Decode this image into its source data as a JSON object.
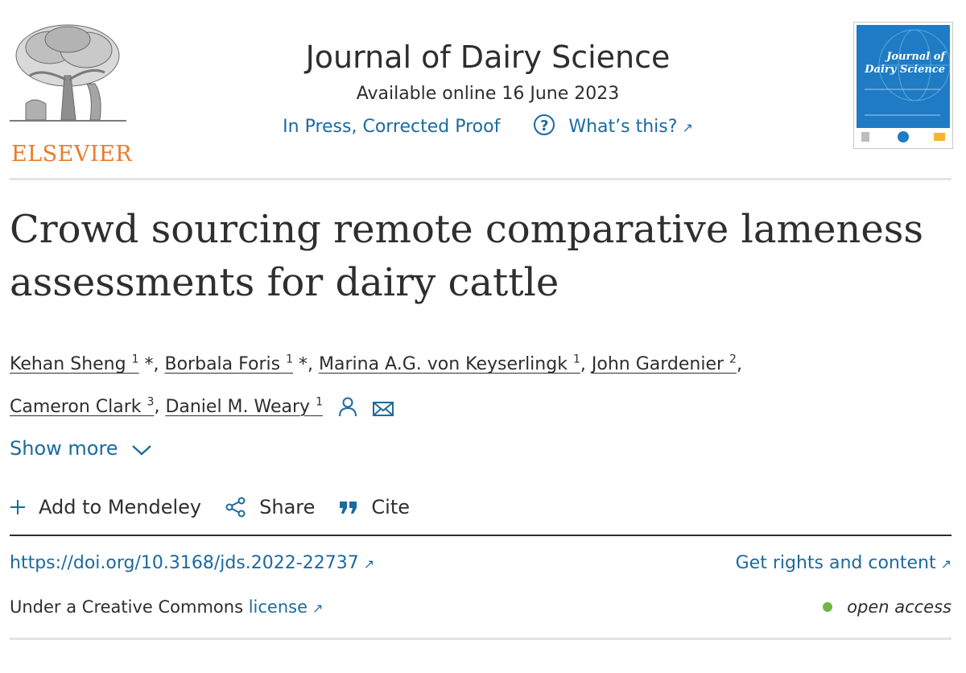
{
  "header": {
    "publisher": "ELSEVIER",
    "journal_title": "Journal of Dairy Science",
    "available_online": "Available online 16 June 2023",
    "status": "In Press, Corrected Proof",
    "whats_this": "What’s this?",
    "cover_title": "Journal of Dairy Science"
  },
  "article": {
    "title": "Crowd sourcing remote comparative lameness assessments for dairy cattle",
    "authors": [
      {
        "name": "Kehan Sheng",
        "sup": "1",
        "suffix": " *, "
      },
      {
        "name": "Borbala Foris",
        "sup": "1",
        "suffix": " *, "
      },
      {
        "name": "Marina A.G. von Keyserlingk",
        "sup": "1",
        "suffix": ", "
      },
      {
        "name": "John Gardenier",
        "sup": "2",
        "suffix": ","
      },
      {
        "name": "Cameron Clark",
        "sup": "3",
        "suffix": ", "
      },
      {
        "name": "Daniel M. Weary",
        "sup": "1",
        "suffix": ""
      }
    ],
    "show_more": "Show more"
  },
  "actions": {
    "mendeley": "Add to Mendeley",
    "share": "Share",
    "cite": "Cite"
  },
  "links": {
    "doi": "https://doi.org/10.3168/jds.2022-22737",
    "rights": "Get rights and content",
    "license_prefix": "Under a Creative Commons ",
    "license_link": "license",
    "open_access": "open access"
  },
  "colors": {
    "link": "#1b6a9f",
    "elsevier_orange": "#ea7b2c",
    "open_access_dot": "#6fb743",
    "cover_blue": "#1f7cc4"
  },
  "icons": [
    "elsevier-tree-logo",
    "question-icon",
    "external-link-icon",
    "person-icon",
    "envelope-icon",
    "chevron-down-icon",
    "plus-icon",
    "share-icon",
    "quote-icon"
  ]
}
